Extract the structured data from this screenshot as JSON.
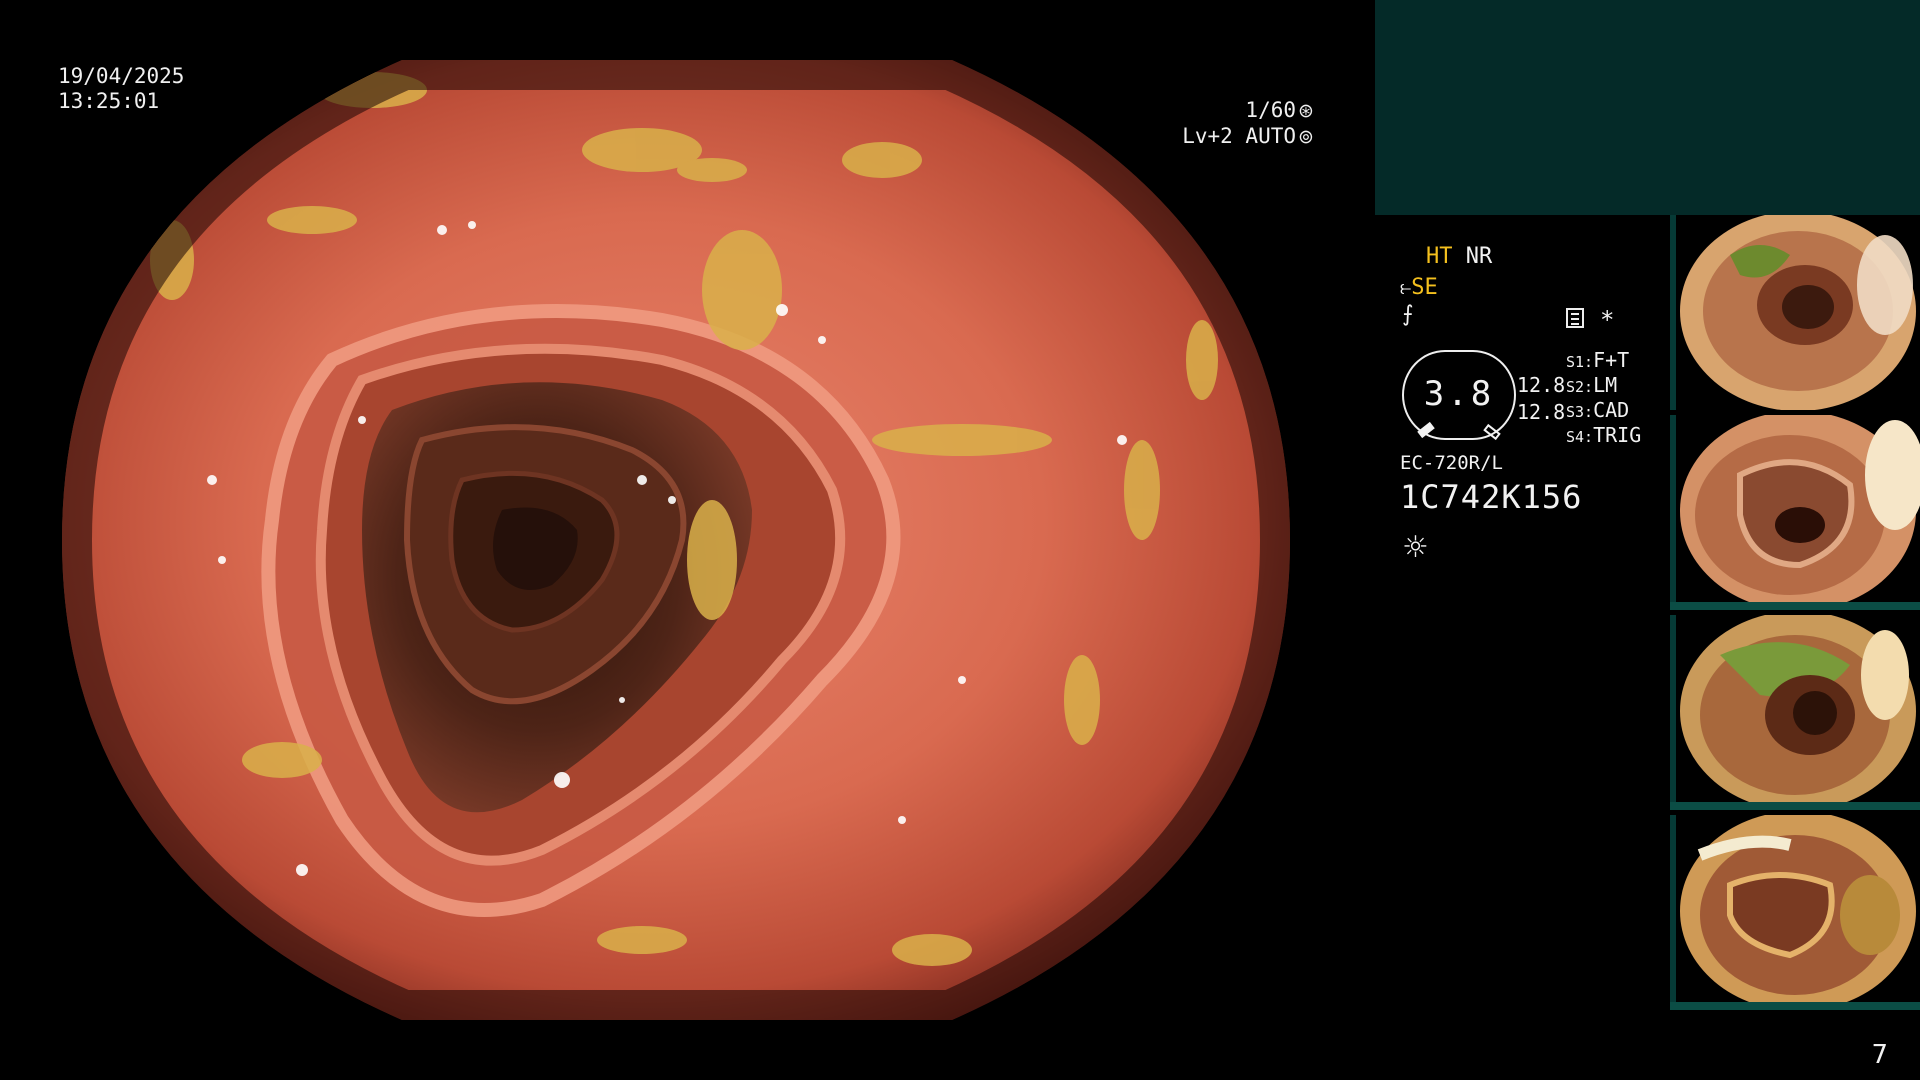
{
  "overlay": {
    "date": "19/04/2025",
    "time": "13:25:01",
    "shutter": "1/60",
    "shutter_icon": "aperture-icon",
    "level": "Lv+2",
    "mode": "AUTO",
    "mode_icon": "iris-icon"
  },
  "status": {
    "ht": "HT",
    "nr": "NR",
    "se": "SE",
    "gauge_value": "3.8",
    "left_values": [
      "12.8",
      "12.8"
    ],
    "switches": [
      {
        "key": "S1:",
        "value": "F+T"
      },
      {
        "key": "S2:",
        "value": "LM"
      },
      {
        "key": "S3:",
        "value": "CAD"
      },
      {
        "key": "S4:",
        "value": "TRIG"
      }
    ],
    "star": "*",
    "scope_model": "EC-720R/L",
    "scope_serial": "1C742K156",
    "icons": [
      "air-icon",
      "freeze-icon",
      "memory-icon",
      "light-icon"
    ]
  },
  "thumbnails": [
    {
      "name": "capture-1"
    },
    {
      "name": "capture-2"
    },
    {
      "name": "capture-3"
    },
    {
      "name": "capture-4"
    }
  ],
  "page": "7",
  "colors": {
    "highlight_yellow": "#f4c01e",
    "panel_teal": "#042a28"
  }
}
